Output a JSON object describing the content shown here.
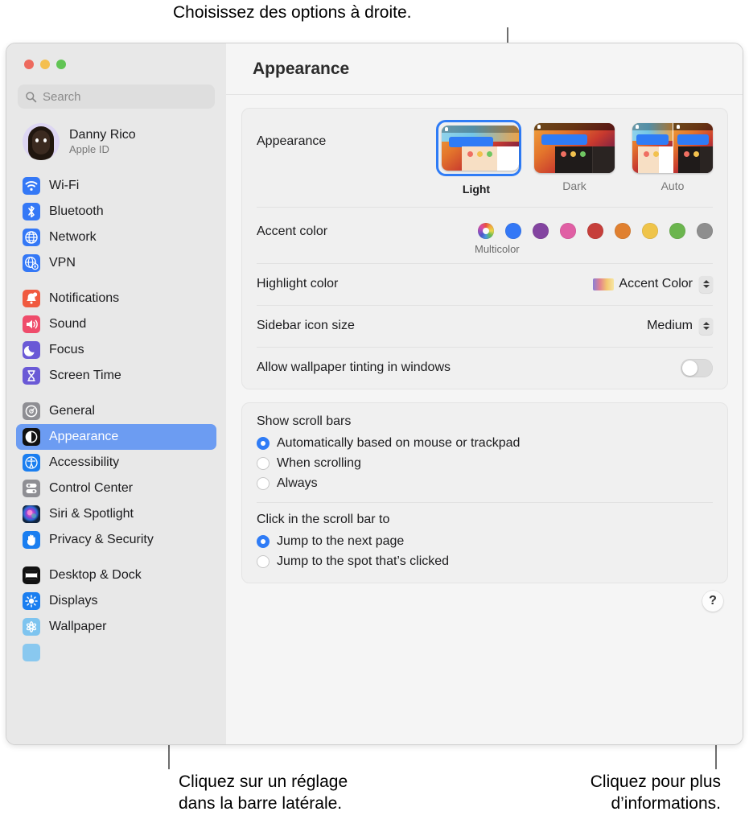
{
  "callouts": {
    "top": "Choisissez des options à droite.",
    "bottom_left": "Cliquez sur un réglage\ndans la barre latérale.",
    "bottom_right": "Cliquez pour plus\nd’informations."
  },
  "window": {
    "title": "Appearance",
    "traffic_lights": [
      "close",
      "minimize",
      "zoom"
    ]
  },
  "sidebar": {
    "search": {
      "placeholder": "Search",
      "value": "",
      "icon": "search-icon"
    },
    "account": {
      "name": "Danny Rico",
      "subtitle": "Apple ID",
      "avatar": "memoji-avatar"
    },
    "groups": [
      {
        "items": [
          {
            "label": "Wi-Fi",
            "icon": "wifi-icon",
            "selected": false
          },
          {
            "label": "Bluetooth",
            "icon": "bluetooth-icon",
            "selected": false
          },
          {
            "label": "Network",
            "icon": "globe-icon",
            "selected": false
          },
          {
            "label": "VPN",
            "icon": "vpn-globe-icon",
            "selected": false
          }
        ]
      },
      {
        "items": [
          {
            "label": "Notifications",
            "icon": "bell-icon",
            "selected": false
          },
          {
            "label": "Sound",
            "icon": "speaker-icon",
            "selected": false
          },
          {
            "label": "Focus",
            "icon": "moon-icon",
            "selected": false
          },
          {
            "label": "Screen Time",
            "icon": "hourglass-icon",
            "selected": false
          }
        ]
      },
      {
        "items": [
          {
            "label": "General",
            "icon": "gear-icon",
            "selected": false
          },
          {
            "label": "Appearance",
            "icon": "appearance-icon",
            "selected": true
          },
          {
            "label": "Accessibility",
            "icon": "accessibility-icon",
            "selected": false
          },
          {
            "label": "Control Center",
            "icon": "control-center-icon",
            "selected": false
          },
          {
            "label": "Siri & Spotlight",
            "icon": "siri-icon",
            "selected": false
          },
          {
            "label": "Privacy & Security",
            "icon": "hand-icon",
            "selected": false
          }
        ]
      },
      {
        "items": [
          {
            "label": "Desktop & Dock",
            "icon": "desktop-dock-icon",
            "selected": false
          },
          {
            "label": "Displays",
            "icon": "brightness-icon",
            "selected": false
          },
          {
            "label": "Wallpaper",
            "icon": "wallpaper-icon",
            "selected": false
          }
        ]
      }
    ]
  },
  "main": {
    "appearance": {
      "label": "Appearance",
      "options": [
        {
          "label": "Light",
          "selected": true
        },
        {
          "label": "Dark",
          "selected": false
        },
        {
          "label": "Auto",
          "selected": false
        }
      ]
    },
    "accent_color": {
      "label": "Accent color",
      "selected_label": "Multicolor",
      "swatches": [
        {
          "name": "Multicolor",
          "color": "multicolor",
          "selected": true
        },
        {
          "name": "Blue",
          "color": "#3478f6",
          "selected": false
        },
        {
          "name": "Purple",
          "color": "#8344a0",
          "selected": false
        },
        {
          "name": "Pink",
          "color": "#e05fa4",
          "selected": false
        },
        {
          "name": "Red",
          "color": "#c63f3b",
          "selected": false
        },
        {
          "name": "Orange",
          "color": "#e08030",
          "selected": false
        },
        {
          "name": "Yellow",
          "color": "#efc44a",
          "selected": false
        },
        {
          "name": "Green",
          "color": "#6bb54e",
          "selected": false
        },
        {
          "name": "Graphite",
          "color": "#8e8e8e",
          "selected": false
        }
      ]
    },
    "highlight_color": {
      "label": "Highlight color",
      "value": "Accent Color"
    },
    "sidebar_icon_size": {
      "label": "Sidebar icon size",
      "value": "Medium"
    },
    "wallpaper_tinting": {
      "label": "Allow wallpaper tinting in windows",
      "enabled": false
    },
    "show_scroll_bars": {
      "title": "Show scroll bars",
      "options": [
        {
          "label": "Automatically based on mouse or trackpad",
          "selected": true
        },
        {
          "label": "When scrolling",
          "selected": false
        },
        {
          "label": "Always",
          "selected": false
        }
      ]
    },
    "click_scroll_bar": {
      "title": "Click in the scroll bar to",
      "options": [
        {
          "label": "Jump to the next page",
          "selected": true
        },
        {
          "label": "Jump to the spot that’s clicked",
          "selected": false
        }
      ]
    },
    "help_button": {
      "label": "?"
    }
  },
  "colors": {
    "accent": "#2f7cf6",
    "selection": "#6c9cf2",
    "sidebar_bg": "#e8e8e8",
    "content_bg": "#f5f5f5"
  }
}
